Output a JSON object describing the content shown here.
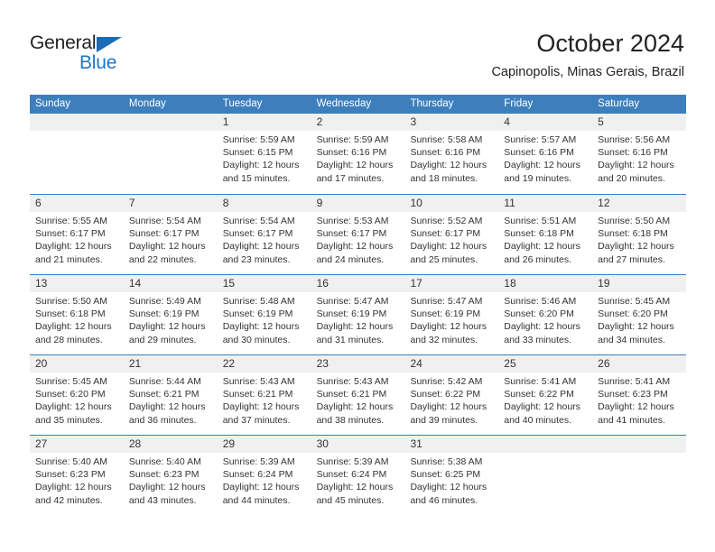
{
  "brand": {
    "name_part1": "General",
    "name_part2": "Blue",
    "triangle_color": "#1b6cb5",
    "blue_color": "#1b76cf"
  },
  "header": {
    "month_title": "October 2024",
    "location": "Capinopolis, Minas Gerais, Brazil"
  },
  "theme": {
    "header_band": "#3d7fbd",
    "date_band": "#f0f0f0",
    "text": "#333333"
  },
  "calendar": {
    "weekday_headers": [
      "Sunday",
      "Monday",
      "Tuesday",
      "Wednesday",
      "Thursday",
      "Friday",
      "Saturday"
    ],
    "labels": {
      "sunrise_prefix": "Sunrise:",
      "sunset_prefix": "Sunset:",
      "daylight_prefix": "Daylight:"
    },
    "weeks": [
      [
        {
          "day": "",
          "empty": true
        },
        {
          "day": "",
          "empty": true
        },
        {
          "day": "1",
          "sunrise": "Sunrise: 5:59 AM",
          "sunset": "Sunset: 6:15 PM",
          "daylight_line1": "Daylight: 12 hours",
          "daylight_line2": "and 15 minutes."
        },
        {
          "day": "2",
          "sunrise": "Sunrise: 5:59 AM",
          "sunset": "Sunset: 6:16 PM",
          "daylight_line1": "Daylight: 12 hours",
          "daylight_line2": "and 17 minutes."
        },
        {
          "day": "3",
          "sunrise": "Sunrise: 5:58 AM",
          "sunset": "Sunset: 6:16 PM",
          "daylight_line1": "Daylight: 12 hours",
          "daylight_line2": "and 18 minutes."
        },
        {
          "day": "4",
          "sunrise": "Sunrise: 5:57 AM",
          "sunset": "Sunset: 6:16 PM",
          "daylight_line1": "Daylight: 12 hours",
          "daylight_line2": "and 19 minutes."
        },
        {
          "day": "5",
          "sunrise": "Sunrise: 5:56 AM",
          "sunset": "Sunset: 6:16 PM",
          "daylight_line1": "Daylight: 12 hours",
          "daylight_line2": "and 20 minutes."
        }
      ],
      [
        {
          "day": "6",
          "sunrise": "Sunrise: 5:55 AM",
          "sunset": "Sunset: 6:17 PM",
          "daylight_line1": "Daylight: 12 hours",
          "daylight_line2": "and 21 minutes."
        },
        {
          "day": "7",
          "sunrise": "Sunrise: 5:54 AM",
          "sunset": "Sunset: 6:17 PM",
          "daylight_line1": "Daylight: 12 hours",
          "daylight_line2": "and 22 minutes."
        },
        {
          "day": "8",
          "sunrise": "Sunrise: 5:54 AM",
          "sunset": "Sunset: 6:17 PM",
          "daylight_line1": "Daylight: 12 hours",
          "daylight_line2": "and 23 minutes."
        },
        {
          "day": "9",
          "sunrise": "Sunrise: 5:53 AM",
          "sunset": "Sunset: 6:17 PM",
          "daylight_line1": "Daylight: 12 hours",
          "daylight_line2": "and 24 minutes."
        },
        {
          "day": "10",
          "sunrise": "Sunrise: 5:52 AM",
          "sunset": "Sunset: 6:17 PM",
          "daylight_line1": "Daylight: 12 hours",
          "daylight_line2": "and 25 minutes."
        },
        {
          "day": "11",
          "sunrise": "Sunrise: 5:51 AM",
          "sunset": "Sunset: 6:18 PM",
          "daylight_line1": "Daylight: 12 hours",
          "daylight_line2": "and 26 minutes."
        },
        {
          "day": "12",
          "sunrise": "Sunrise: 5:50 AM",
          "sunset": "Sunset: 6:18 PM",
          "daylight_line1": "Daylight: 12 hours",
          "daylight_line2": "and 27 minutes."
        }
      ],
      [
        {
          "day": "13",
          "sunrise": "Sunrise: 5:50 AM",
          "sunset": "Sunset: 6:18 PM",
          "daylight_line1": "Daylight: 12 hours",
          "daylight_line2": "and 28 minutes."
        },
        {
          "day": "14",
          "sunrise": "Sunrise: 5:49 AM",
          "sunset": "Sunset: 6:19 PM",
          "daylight_line1": "Daylight: 12 hours",
          "daylight_line2": "and 29 minutes."
        },
        {
          "day": "15",
          "sunrise": "Sunrise: 5:48 AM",
          "sunset": "Sunset: 6:19 PM",
          "daylight_line1": "Daylight: 12 hours",
          "daylight_line2": "and 30 minutes."
        },
        {
          "day": "16",
          "sunrise": "Sunrise: 5:47 AM",
          "sunset": "Sunset: 6:19 PM",
          "daylight_line1": "Daylight: 12 hours",
          "daylight_line2": "and 31 minutes."
        },
        {
          "day": "17",
          "sunrise": "Sunrise: 5:47 AM",
          "sunset": "Sunset: 6:19 PM",
          "daylight_line1": "Daylight: 12 hours",
          "daylight_line2": "and 32 minutes."
        },
        {
          "day": "18",
          "sunrise": "Sunrise: 5:46 AM",
          "sunset": "Sunset: 6:20 PM",
          "daylight_line1": "Daylight: 12 hours",
          "daylight_line2": "and 33 minutes."
        },
        {
          "day": "19",
          "sunrise": "Sunrise: 5:45 AM",
          "sunset": "Sunset: 6:20 PM",
          "daylight_line1": "Daylight: 12 hours",
          "daylight_line2": "and 34 minutes."
        }
      ],
      [
        {
          "day": "20",
          "sunrise": "Sunrise: 5:45 AM",
          "sunset": "Sunset: 6:20 PM",
          "daylight_line1": "Daylight: 12 hours",
          "daylight_line2": "and 35 minutes."
        },
        {
          "day": "21",
          "sunrise": "Sunrise: 5:44 AM",
          "sunset": "Sunset: 6:21 PM",
          "daylight_line1": "Daylight: 12 hours",
          "daylight_line2": "and 36 minutes."
        },
        {
          "day": "22",
          "sunrise": "Sunrise: 5:43 AM",
          "sunset": "Sunset: 6:21 PM",
          "daylight_line1": "Daylight: 12 hours",
          "daylight_line2": "and 37 minutes."
        },
        {
          "day": "23",
          "sunrise": "Sunrise: 5:43 AM",
          "sunset": "Sunset: 6:21 PM",
          "daylight_line1": "Daylight: 12 hours",
          "daylight_line2": "and 38 minutes."
        },
        {
          "day": "24",
          "sunrise": "Sunrise: 5:42 AM",
          "sunset": "Sunset: 6:22 PM",
          "daylight_line1": "Daylight: 12 hours",
          "daylight_line2": "and 39 minutes."
        },
        {
          "day": "25",
          "sunrise": "Sunrise: 5:41 AM",
          "sunset": "Sunset: 6:22 PM",
          "daylight_line1": "Daylight: 12 hours",
          "daylight_line2": "and 40 minutes."
        },
        {
          "day": "26",
          "sunrise": "Sunrise: 5:41 AM",
          "sunset": "Sunset: 6:23 PM",
          "daylight_line1": "Daylight: 12 hours",
          "daylight_line2": "and 41 minutes."
        }
      ],
      [
        {
          "day": "27",
          "sunrise": "Sunrise: 5:40 AM",
          "sunset": "Sunset: 6:23 PM",
          "daylight_line1": "Daylight: 12 hours",
          "daylight_line2": "and 42 minutes."
        },
        {
          "day": "28",
          "sunrise": "Sunrise: 5:40 AM",
          "sunset": "Sunset: 6:23 PM",
          "daylight_line1": "Daylight: 12 hours",
          "daylight_line2": "and 43 minutes."
        },
        {
          "day": "29",
          "sunrise": "Sunrise: 5:39 AM",
          "sunset": "Sunset: 6:24 PM",
          "daylight_line1": "Daylight: 12 hours",
          "daylight_line2": "and 44 minutes."
        },
        {
          "day": "30",
          "sunrise": "Sunrise: 5:39 AM",
          "sunset": "Sunset: 6:24 PM",
          "daylight_line1": "Daylight: 12 hours",
          "daylight_line2": "and 45 minutes."
        },
        {
          "day": "31",
          "sunrise": "Sunrise: 5:38 AM",
          "sunset": "Sunset: 6:25 PM",
          "daylight_line1": "Daylight: 12 hours",
          "daylight_line2": "and 46 minutes."
        },
        {
          "day": "",
          "empty": true
        },
        {
          "day": "",
          "empty": true
        }
      ]
    ]
  }
}
